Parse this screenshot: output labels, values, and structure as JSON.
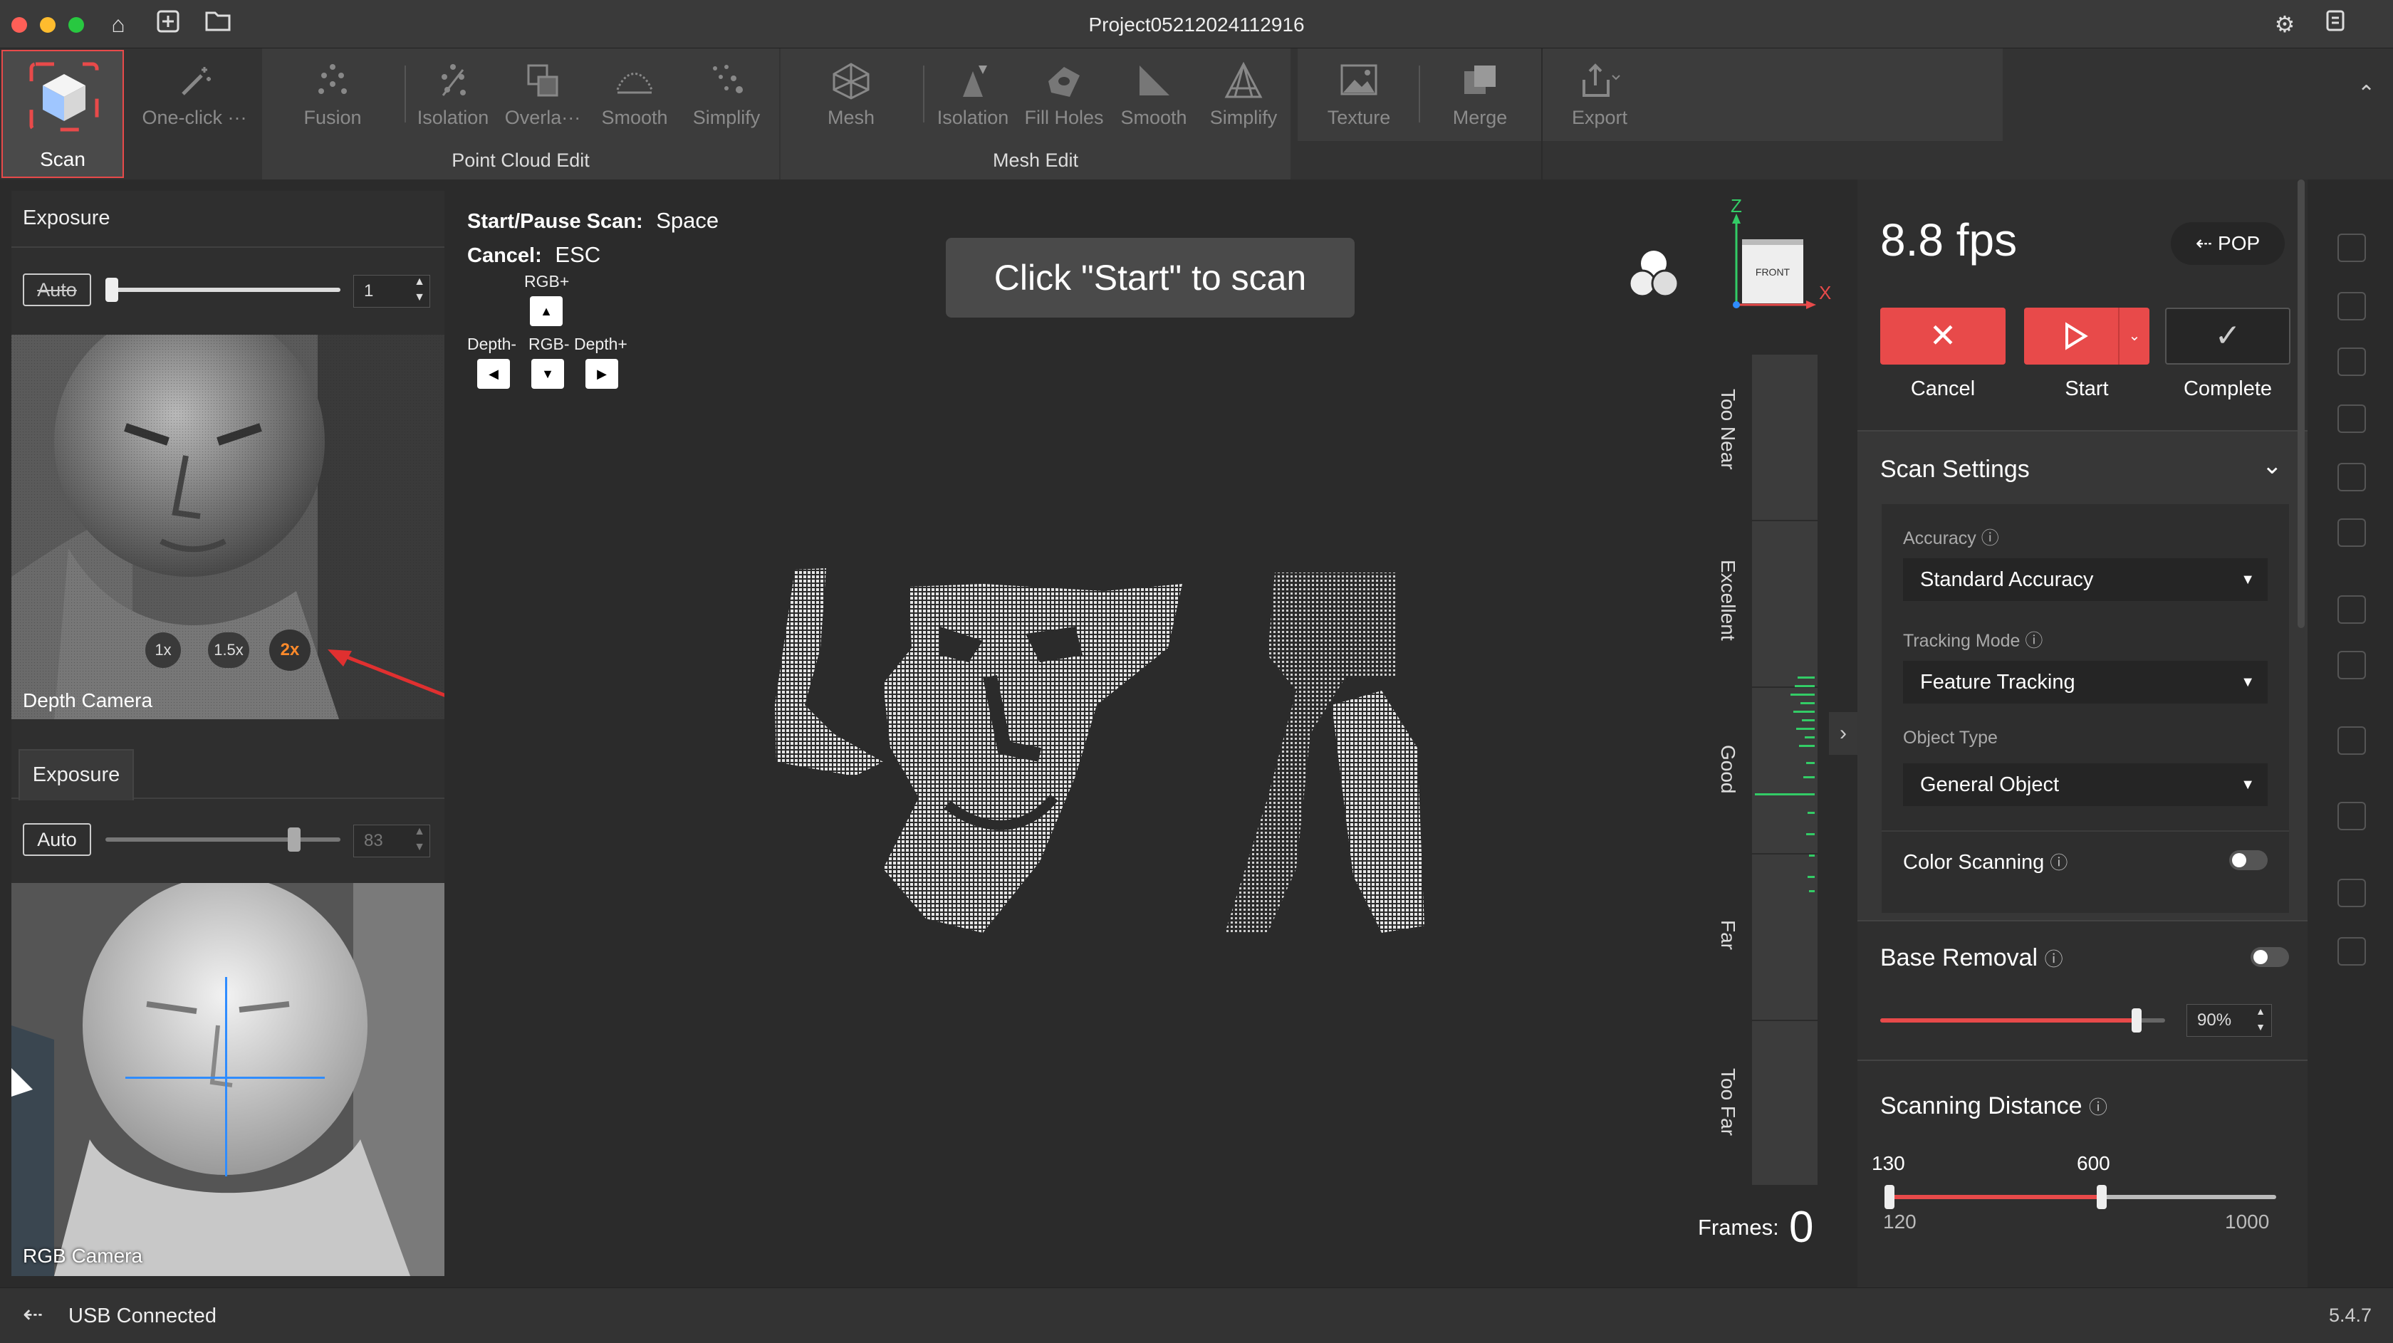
{
  "titlebar": {
    "title": "Project05212024112916"
  },
  "toolbar": {
    "scan": "Scan",
    "one_click": "One-click ···",
    "pc_items": [
      "Fusion",
      "Isolation",
      "Overla···",
      "Smooth",
      "Simplify"
    ],
    "pc_group": "Point Cloud Edit",
    "mesh_items": [
      "Mesh",
      "Isolation",
      "Fill Holes",
      "Smooth",
      "Simplify"
    ],
    "mesh_group": "Mesh Edit",
    "texture": "Texture",
    "merge": "Merge",
    "export": "Export"
  },
  "depth": {
    "exposure_label": "Exposure",
    "auto_label": "Auto",
    "value": "1",
    "zoom": [
      "1x",
      "1.5x",
      "2x"
    ],
    "caption": "Depth Camera"
  },
  "rgb": {
    "exposure_tab": "Exposure",
    "auto_label": "Auto",
    "value": "83",
    "caption": "RGB Camera"
  },
  "viewport": {
    "start_pause_label": "Start/Pause Scan:",
    "start_pause_key": "Space",
    "cancel_label": "Cancel:",
    "cancel_key": "ESC",
    "rgb_plus": "RGB+",
    "depth_minus": "Depth-",
    "rgb_minus": "RGB-",
    "depth_plus": "Depth+",
    "toast": "Click \"Start\" to scan",
    "axis_z": "Z",
    "axis_x": "X",
    "cube_face": "FRONT",
    "distance_labels": [
      "Too Near",
      "Excellent",
      "Good",
      "Far",
      "Too Far"
    ],
    "frames_label": "Frames:",
    "frames_value": "0"
  },
  "right": {
    "fps": "8.8 fps",
    "pop": "POP",
    "cancel": "Cancel",
    "start": "Start",
    "complete": "Complete",
    "scan_settings": "Scan Settings",
    "accuracy_label": "Accuracy",
    "accuracy_value": "Standard Accuracy",
    "tracking_label": "Tracking Mode",
    "tracking_value": "Feature Tracking",
    "object_label": "Object Type",
    "object_value": "General Object",
    "color_scanning": "Color Scanning",
    "base_removal": "Base Removal",
    "base_removal_value": "90%",
    "base_removal_level": 0.9,
    "scanning_distance": "Scanning Distance",
    "dist_low": "130",
    "dist_high": "600",
    "dist_min": "120",
    "dist_max": "1000"
  },
  "status": {
    "usb": "USB Connected",
    "version": "5.4.7"
  },
  "colors": {
    "accent_red": "#e84a4a",
    "axis_blue": "#2f8cff",
    "axis_green": "#33cc66",
    "zoom_active": "#ff8a2a"
  }
}
